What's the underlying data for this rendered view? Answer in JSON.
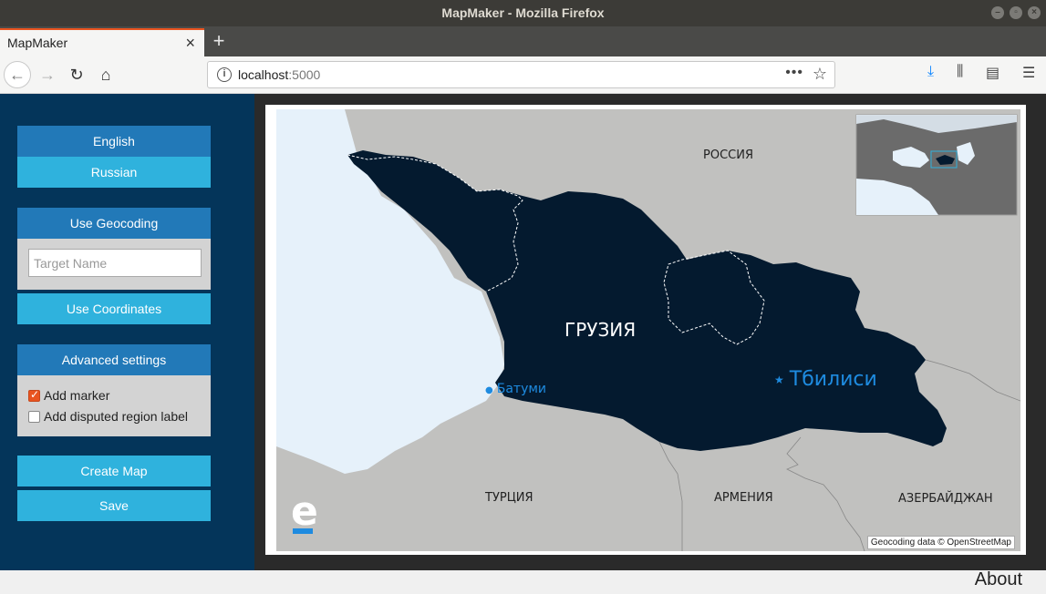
{
  "window": {
    "title": "MapMaker - Mozilla Firefox"
  },
  "tab": {
    "title": "MapMaker",
    "close": "×",
    "new_tab": "+"
  },
  "nav": {
    "url_host": "localhost",
    "url_port": ":5000"
  },
  "sidebar": {
    "lang_english": "English",
    "lang_russian": "Russian",
    "use_geocoding": "Use Geocoding",
    "target_placeholder": "Target Name",
    "use_coordinates": "Use Coordinates",
    "advanced_settings": "Advanced settings",
    "add_marker": {
      "label": "Add marker",
      "checked": true
    },
    "add_disputed": {
      "label": "Add disputed region label",
      "checked": false
    },
    "create_map": "Create Map",
    "save": "Save"
  },
  "map": {
    "labels": {
      "russia": "РОССИЯ",
      "georgia": "ГРУЗИЯ",
      "batumi": "Батуми",
      "tbilisi": "Тбилиси",
      "turkey": "ТУРЦИЯ",
      "armenia": "АРМЕНИЯ",
      "azerbaijan": "АЗЕРБАЙДЖАН"
    },
    "attribution": "Geocoding data © OpenStreetMap",
    "logo": "e",
    "colors": {
      "country": "#041a2f",
      "sea": "#e6f1fa",
      "land": "#c1c1bf",
      "city": "#1e8be0"
    }
  },
  "footer": {
    "about": "About"
  }
}
